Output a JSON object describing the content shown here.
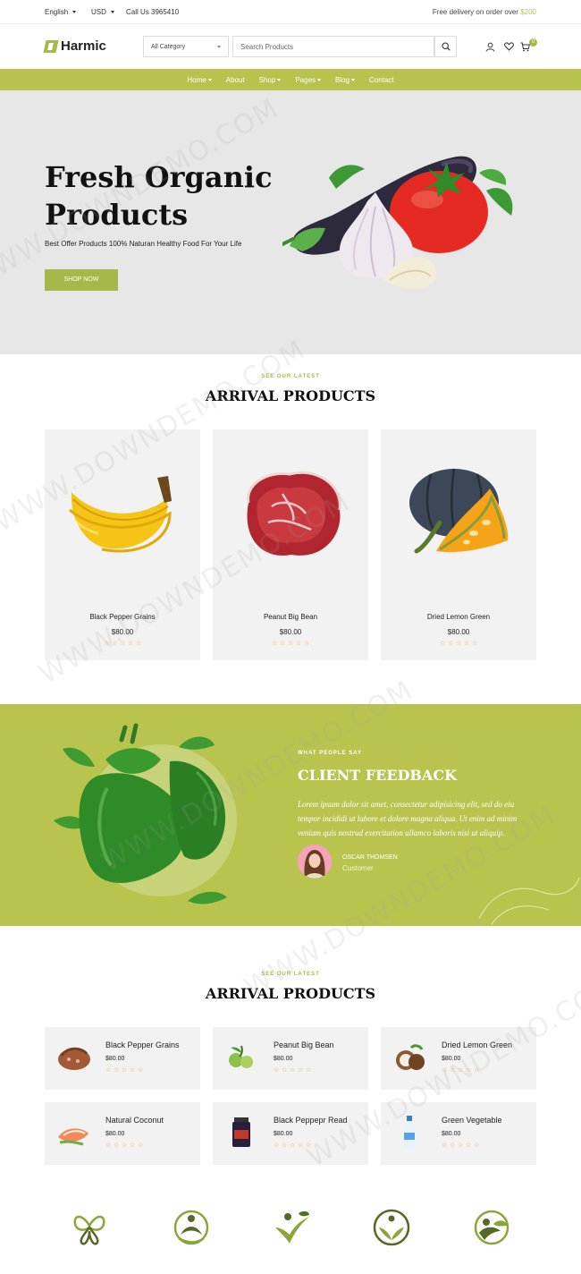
{
  "topbar": {
    "language": "English",
    "currency": "USD",
    "phone": "Call Us 3965410",
    "delivery_text": "Free delivery on order over",
    "delivery_amount": "$200"
  },
  "header": {
    "logo": "Harmic",
    "category_select": "All Category",
    "search_placeholder": "Search Products",
    "cart_count": "0"
  },
  "nav": {
    "items": [
      "Home",
      "About",
      "Shop",
      "Pages",
      "Blog",
      "Contact"
    ]
  },
  "hero": {
    "title_line1": "Fresh Organic",
    "title_line2": "Products",
    "subtitle": "Best Offer Products 100% Naturan Healthy Food For Your Life",
    "button": "SHOP NOW"
  },
  "arrivals": {
    "label": "SEE OUR LATEST",
    "title": "ARRIVAL PRODUCTS",
    "products": [
      {
        "name": "Black Pepper Grains",
        "price": "$80.00",
        "rating": 5
      },
      {
        "name": "Peanut Big Bean",
        "price": "$80.00",
        "rating": 5
      },
      {
        "name": "Dried Lemon Green",
        "price": "$80.00",
        "rating": 5
      }
    ]
  },
  "feedback": {
    "label": "WHAT PEOPLE SAY",
    "title": "CLIENT FEEDBACK",
    "text": "Lorem ipsum dolor sit amet, consectetur adipisicing elit, sed do eiu tempor incididi ut labore et dolore magna aliqua. Ut enim ad minim veniam quis nostrud exercitation ullamco laboris nisi ut aliquip.",
    "name": "OSCAR THOMSEN",
    "role": "Customer"
  },
  "arrivals2": {
    "label": "SEE OUR LATEST",
    "title": "ARRIVAL PRODUCTS",
    "products": [
      {
        "name": "Black Pepper Grains",
        "price": "$80.00",
        "rating": 5
      },
      {
        "name": "Peanut Big Bean",
        "price": "$80.00",
        "rating": 5
      },
      {
        "name": "Dried Lemon Green",
        "price": "$80.00",
        "rating": 5
      },
      {
        "name": "Natural Coconut",
        "price": "$80.00",
        "rating": 5
      },
      {
        "name": "Black Peppepr Read",
        "price": "$80.00",
        "rating": 5
      },
      {
        "name": "Green Vegetable",
        "price": "$80.00",
        "rating": 5
      }
    ]
  },
  "watermark": "WWW.DOWNDEMO.COM",
  "colors": {
    "accent": "#b7c34d",
    "star": "#e8a73a",
    "hero_bg": "#e7e7e7",
    "card_bg": "#f2f2f2"
  }
}
